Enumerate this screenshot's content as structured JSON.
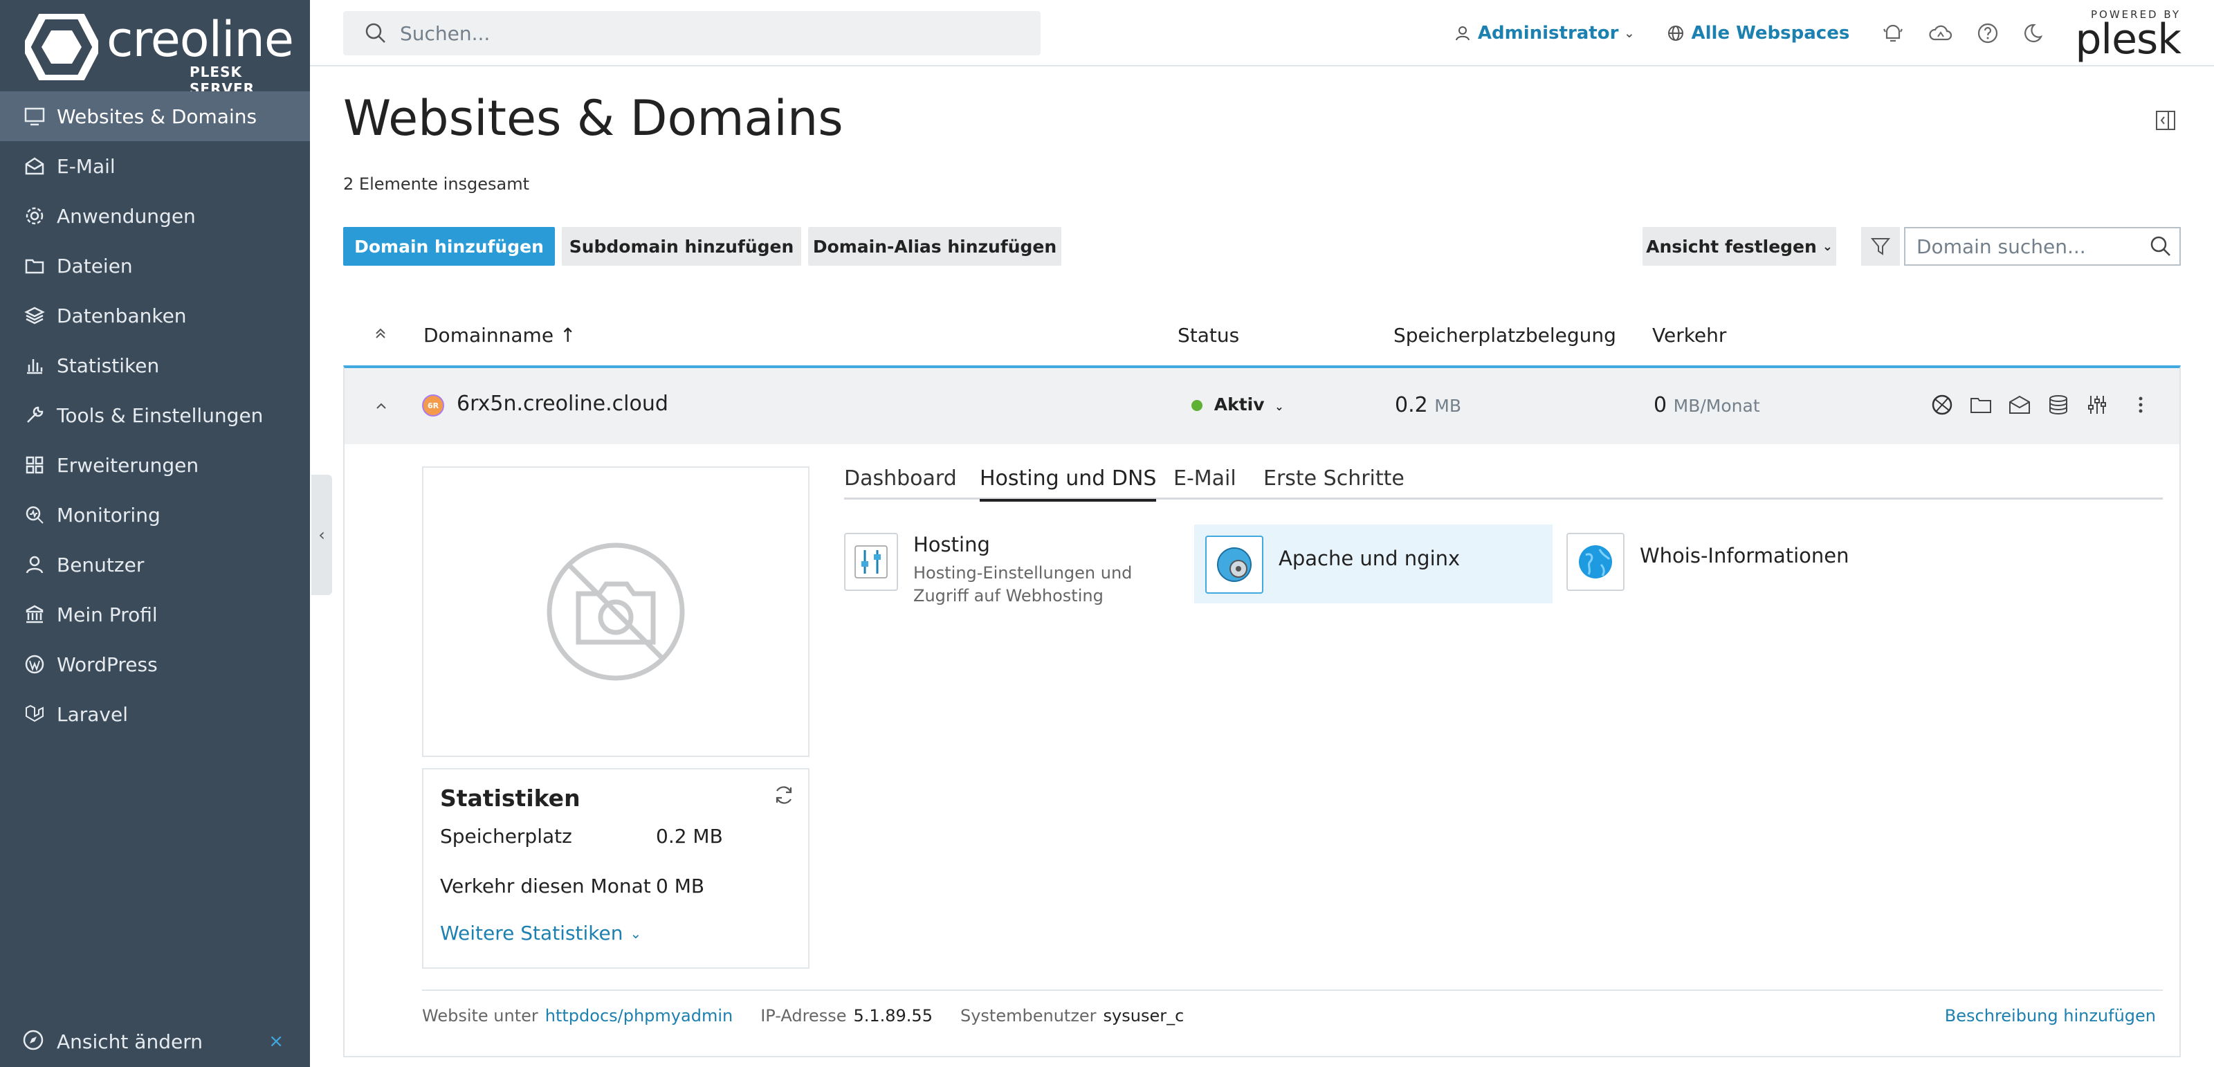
{
  "sidebar": {
    "brand": "creoline",
    "brand_sub": "PLESK SERVER",
    "items": [
      {
        "label": "Websites & Domains",
        "icon": "monitor-icon",
        "active": true
      },
      {
        "label": "E-Mail",
        "icon": "mail-icon"
      },
      {
        "label": "Anwendungen",
        "icon": "gear-icon"
      },
      {
        "label": "Dateien",
        "icon": "folder-icon"
      },
      {
        "label": "Datenbanken",
        "icon": "layers-icon"
      },
      {
        "label": "Statistiken",
        "icon": "bar-chart-icon"
      },
      {
        "label": "Tools & Einstellungen",
        "icon": "tools-icon"
      },
      {
        "label": "Erweiterungen",
        "icon": "grid-icon"
      },
      {
        "label": "Monitoring",
        "icon": "monitoring-icon"
      },
      {
        "label": "Benutzer",
        "icon": "user-icon"
      },
      {
        "label": "Mein Profil",
        "icon": "profile-icon"
      },
      {
        "label": "WordPress",
        "icon": "wordpress-icon"
      },
      {
        "label": "Laravel",
        "icon": "laravel-icon"
      }
    ],
    "footer_label": "Ansicht ändern",
    "footer_close": "×",
    "collapse": "‹"
  },
  "header": {
    "search_placeholder": "Suchen...",
    "user": "Administrator",
    "webspaces": "Alle Webspaces",
    "powered_by": "POWERED BY",
    "plesk": "plesk"
  },
  "main": {
    "title": "Websites & Domains",
    "count": "2 Elemente insgesamt",
    "buttons": {
      "add_domain": "Domain hinzufügen",
      "add_subdomain": "Subdomain hinzufügen",
      "add_alias": "Domain-Alias hinzufügen",
      "view": "Ansicht festlegen"
    },
    "domain_search_placeholder": "Domain suchen...",
    "columns": {
      "name": "Domainname ↑",
      "status": "Status",
      "storage": "Speicherplatzbelegung",
      "traffic": "Verkehr"
    },
    "row": {
      "avatar": "6R",
      "domain": "6rx5n.creoline.cloud",
      "status": "Aktiv",
      "storage_value": "0.2",
      "storage_unit": "MB",
      "traffic_value": "0",
      "traffic_unit": "MB/Monat"
    },
    "stats": {
      "title": "Statistiken",
      "storage_label": "Speicherplatz",
      "storage_value": "0.2 MB",
      "traffic_label": "Verkehr diesen Monat",
      "traffic_value": "0 MB",
      "more": "Weitere Statistiken"
    },
    "tabs": [
      "Dashboard",
      "Hosting und DNS",
      "E-Mail",
      "Erste Schritte"
    ],
    "tools": {
      "hosting_title": "Hosting",
      "hosting_desc": "Hosting-Einstellungen und Zugriff auf Webhosting",
      "apache_title": "Apache und nginx",
      "whois_title": "Whois-Informationen"
    },
    "footer": {
      "website_label": "Website unter",
      "website_path": "httpdocs/phpmyadmin",
      "ip_label": "IP-Adresse",
      "ip": "5.1.89.55",
      "sysuser_label": "Systembenutzer",
      "sysuser": "sysuser_c",
      "add_desc": "Beschreibung hinzufügen"
    }
  },
  "colors": {
    "sidebar_bg": "#3c4b5a",
    "sidebar_active": "#56687a",
    "primary": "#2a9bd6",
    "link": "#1c80b0",
    "active_status": "#5fb135"
  }
}
